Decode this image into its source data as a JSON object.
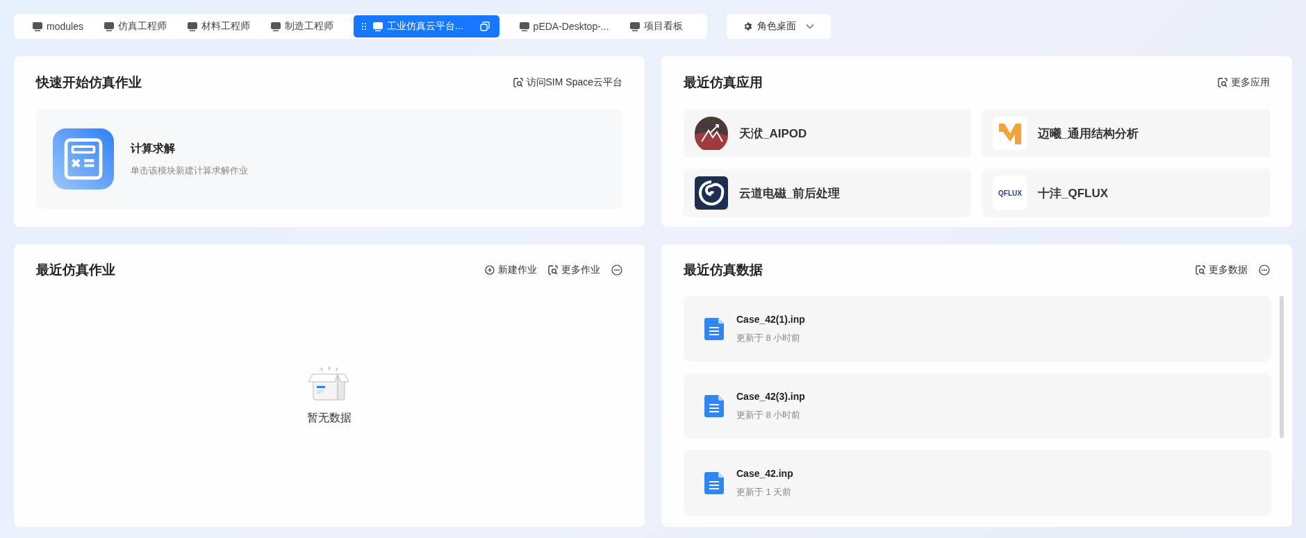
{
  "tabs": [
    {
      "label": "modules",
      "selected": false
    },
    {
      "label": "仿真工程师",
      "selected": false
    },
    {
      "label": "材料工程师",
      "selected": false
    },
    {
      "label": "制造工程师",
      "selected": false
    },
    {
      "label": "工业仿真云平台...",
      "selected": true
    },
    {
      "label": "pEDA-Desktop-...",
      "selected": false
    },
    {
      "label": "项目看板",
      "selected": false
    }
  ],
  "role_menu": {
    "label": "角色桌面"
  },
  "quick_start": {
    "title": "快速开始仿真作业",
    "link": "访问SIM Space云平台",
    "module": {
      "title": "计算求解",
      "description": "单击该模块新建计算求解作业"
    }
  },
  "recent_apps": {
    "title": "最近仿真应用",
    "link": "更多应用",
    "apps": [
      {
        "name": "天洑_AIPOD",
        "kind": "mountain"
      },
      {
        "name": "迈曦_通用结构分析",
        "kind": "m-letter"
      },
      {
        "name": "云道电磁_前后处理",
        "kind": "swirl"
      },
      {
        "name": "十沣_QFLUX",
        "kind": "wordmark",
        "logo_text": "QFLUX"
      }
    ]
  },
  "recent_jobs": {
    "title": "最近仿真作业",
    "actions": [
      {
        "label": "新建作业",
        "kind": "add"
      },
      {
        "label": "更多作业",
        "kind": "search"
      }
    ],
    "empty_text": "暂无数据"
  },
  "recent_data": {
    "title": "最近仿真数据",
    "actions": [
      {
        "label": "更多数据",
        "kind": "search"
      }
    ],
    "files": [
      {
        "name": "Case_42(1).inp",
        "updated": "更新于 8 小时前"
      },
      {
        "name": "Case_42(3).inp",
        "updated": "更新于 8 小时前"
      },
      {
        "name": "Case_42.inp",
        "updated": "更新于 1 天前"
      }
    ]
  }
}
